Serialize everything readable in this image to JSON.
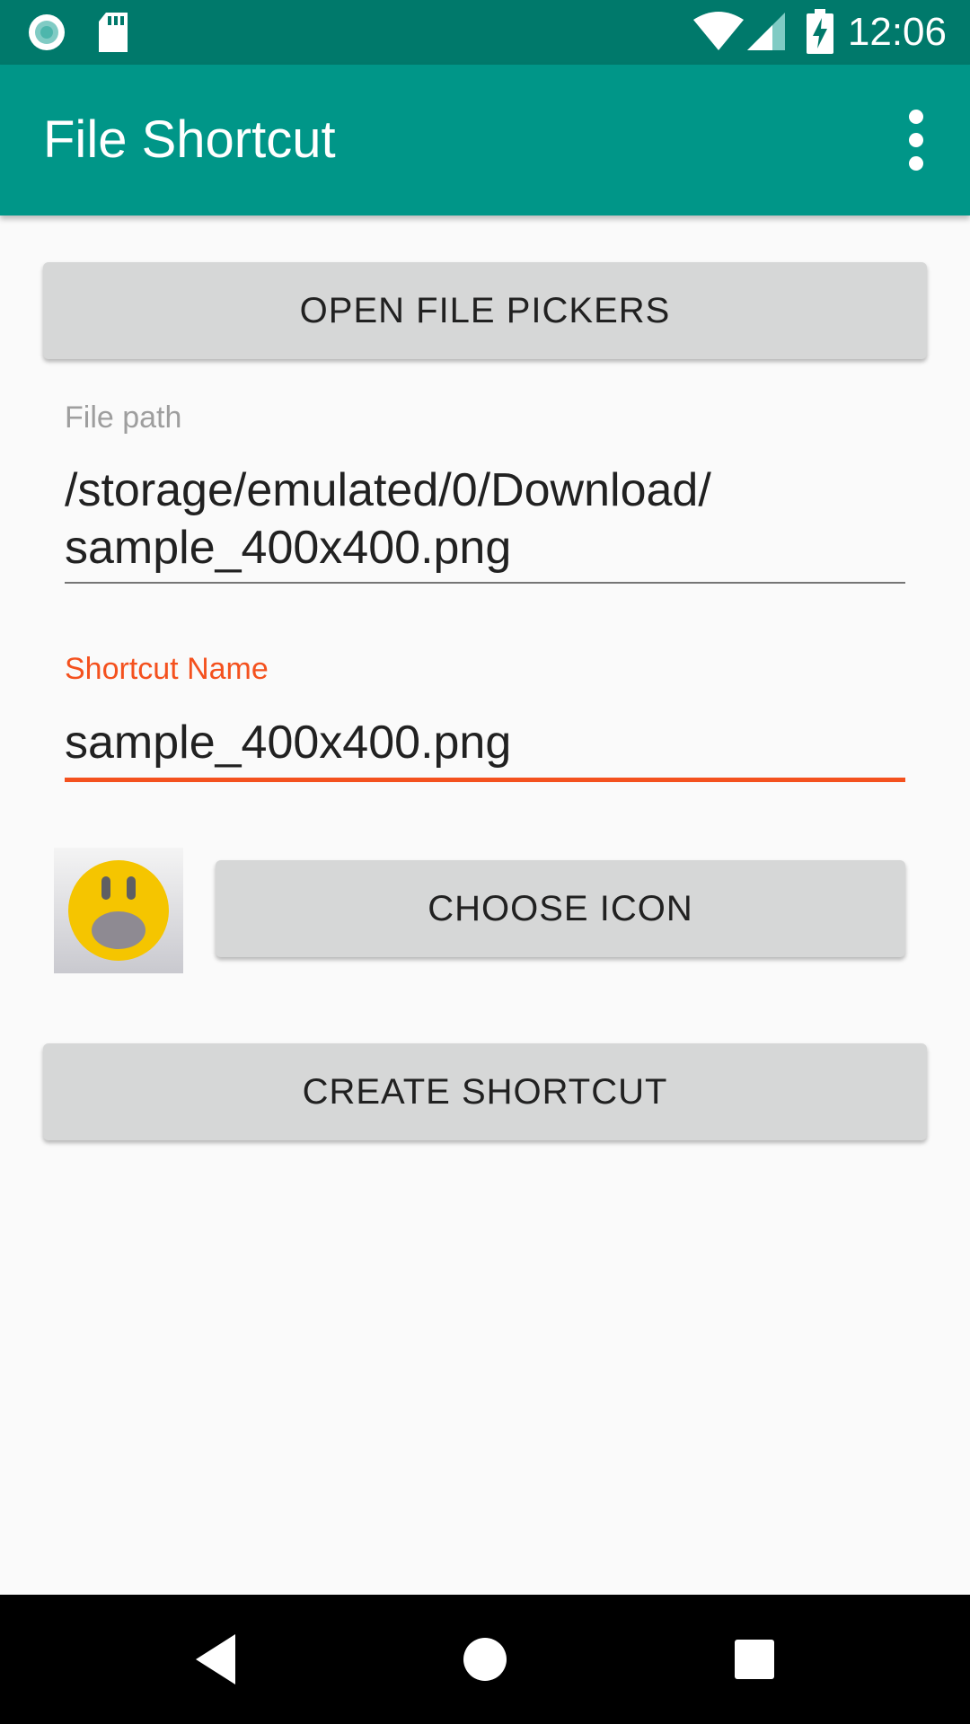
{
  "status_bar": {
    "time": "12:06",
    "icons": [
      "record-icon",
      "sd-card-icon",
      "wifi-icon",
      "signal-icon",
      "battery-charging-icon"
    ]
  },
  "app_bar": {
    "title": "File Shortcut",
    "menu_icon": "overflow-menu-icon"
  },
  "main": {
    "open_pickers_label": "OPEN FILE PICKERS",
    "file_path": {
      "label": "File path",
      "value": "/storage/emulated/0/Download/\nsample_400x400.png"
    },
    "shortcut_name": {
      "label": "Shortcut Name",
      "value": "sample_400x400.png"
    },
    "icon_preview": "surprised-face-icon",
    "choose_icon_label": "CHOOSE ICON",
    "create_shortcut_label": "CREATE SHORTCUT"
  },
  "nav_bar": {
    "buttons": [
      "back-icon",
      "home-icon",
      "recents-icon"
    ]
  },
  "colors": {
    "status_bar": "#00796b",
    "app_bar": "#009688",
    "accent": "#f4511e",
    "button": "#d6d7d7",
    "background": "#fafafa"
  }
}
